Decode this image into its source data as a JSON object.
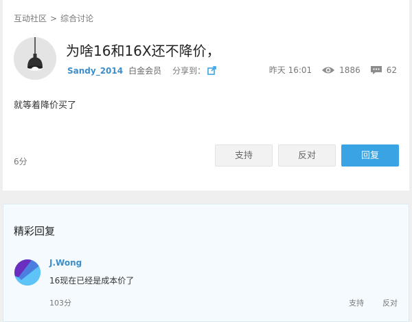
{
  "breadcrumb": {
    "items": [
      "互动社区",
      "综合讨论"
    ],
    "separator": ">"
  },
  "post": {
    "title": "为啥16和16X还不降价，",
    "author": "Sandy_2014",
    "rank": "白金会员",
    "share_label": "分享到：",
    "time": "昨天 16:01",
    "views": "1886",
    "comments": "62",
    "content": "就等着降价买了",
    "score": "6分",
    "buttons": {
      "support": "支持",
      "oppose": "反对",
      "reply": "回复"
    }
  },
  "highlight_replies": {
    "heading": "精彩回复",
    "items": [
      {
        "author": "J.Wong",
        "text": "16现在已经是成本价了",
        "score": "103分",
        "support": "支持",
        "oppose": "反对"
      }
    ]
  },
  "icons": {
    "share": "share-external-icon",
    "views": "eye-icon",
    "comments": "comment-icon"
  },
  "colors": {
    "accent": "#3aa3e3",
    "username": "#3d8ec9",
    "background": "#efefef"
  }
}
